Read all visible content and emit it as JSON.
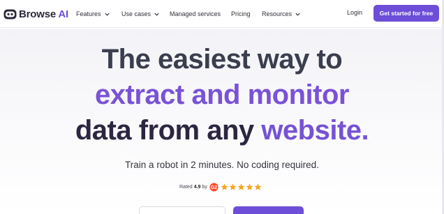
{
  "brand": {
    "name": "Browse",
    "suffix": "AI"
  },
  "nav": {
    "features": "Features",
    "use_cases": "Use cases",
    "managed_services": "Managed services",
    "pricing": "Pricing",
    "resources": "Resources",
    "login": "Login",
    "cta": "Get started for free"
  },
  "hero": {
    "line1": "The easiest way to",
    "line2": "extract and monitor",
    "line3_a": "data from any ",
    "line3_b": "website.",
    "subtitle": "Train a robot in 2 minutes. No coding required."
  },
  "rating": {
    "prefix": "Rated",
    "score": "4.9",
    "by": "by",
    "stars": 5,
    "star_color": "#f6a623"
  },
  "form": {
    "input_value": ""
  },
  "colors": {
    "accent": "#6d4ed8",
    "heading": "#3a3e4e"
  }
}
